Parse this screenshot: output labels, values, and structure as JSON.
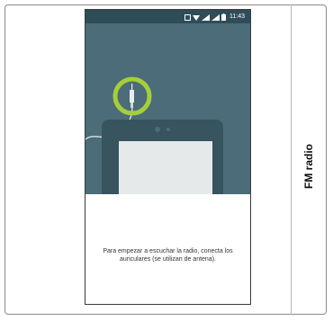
{
  "side_label": "FM radio",
  "status_bar": {
    "time": "11:43",
    "icons": [
      "notification-icon",
      "wifi-icon",
      "signal-icon",
      "signal-icon",
      "battery-icon"
    ]
  },
  "message": "Para empezar a escuchar la radio, conecta los auriculares (se utilizan de antena).",
  "colors": {
    "illustration_bg": "#4b6c78",
    "status_bar_bg": "#2f4d58",
    "highlight_ring": "#a6ce39",
    "device_fill": "#e6e9ea"
  }
}
